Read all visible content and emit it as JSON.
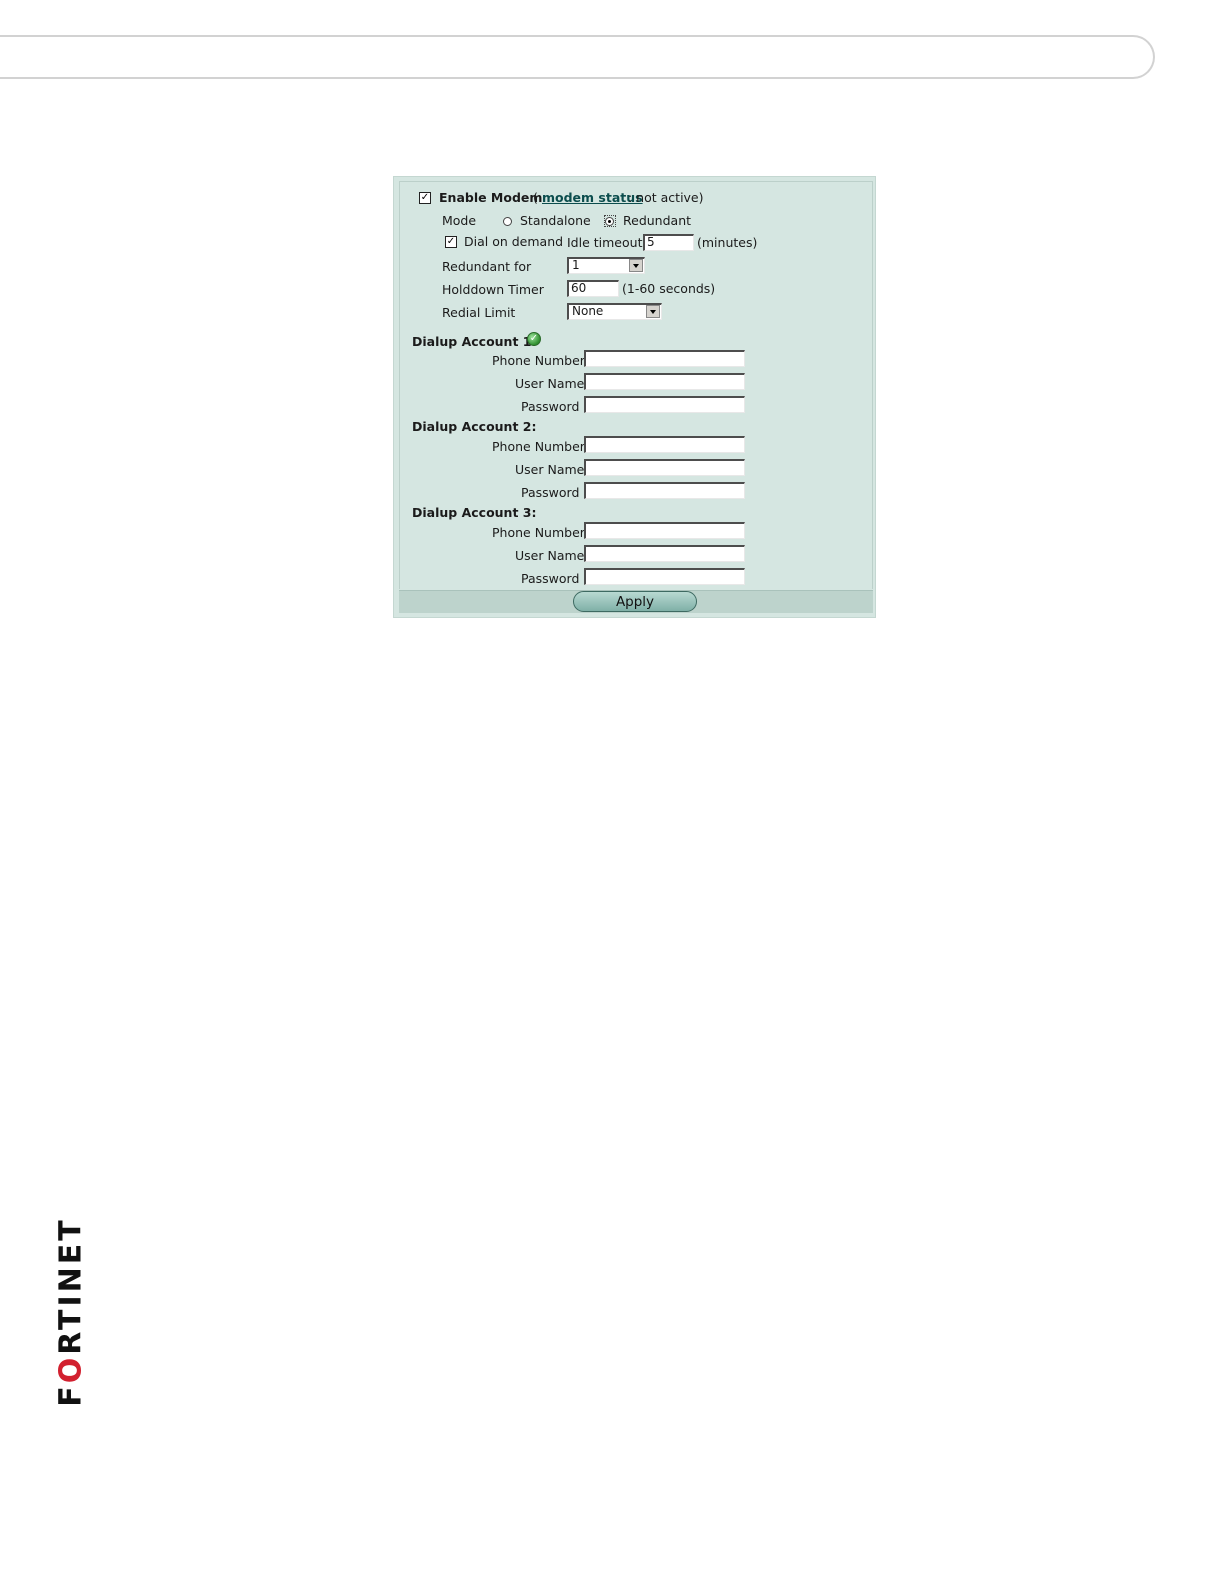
{
  "form": {
    "enable_modem_label": "Enable Modem",
    "status_open": "(",
    "modem_status_link": "modem status",
    "status_text": ": not active)",
    "mode_label": "Mode",
    "mode_standalone": "Standalone",
    "mode_redundant": "Redundant",
    "dial_on_demand_label": "Dial on demand",
    "idle_timeout_label": "Idle timeout",
    "idle_timeout_value": "5",
    "idle_timeout_unit": "(minutes)",
    "redundant_for_label": "Redundant for",
    "redundant_for_value": "1",
    "holddown_label": "Holddown Timer",
    "holddown_value": "60",
    "holddown_unit": "(1-60 seconds)",
    "redial_label": "Redial Limit",
    "redial_value": "None",
    "enable_modem_checked": true,
    "dial_on_demand_checked": true,
    "mode_selected": "Redundant"
  },
  "accounts": [
    {
      "title": "Dialup Account 1:",
      "phone_label": "Phone Number",
      "user_label": "User Name",
      "password_label": "Password",
      "phone": "",
      "user": "",
      "password": ""
    },
    {
      "title": "Dialup Account 2:",
      "phone_label": "Phone Number",
      "user_label": "User Name",
      "password_label": "Password",
      "phone": "",
      "user": "",
      "password": ""
    },
    {
      "title": "Dialup Account 3:",
      "phone_label": "Phone Number",
      "user_label": "User Name",
      "password_label": "Password",
      "phone": "",
      "user": "",
      "password": ""
    }
  ],
  "apply_label": "Apply",
  "logo": {
    "text_prefix": "F",
    "text_red": "O",
    "text_suffix": "RTINET",
    "brand_color": "#d2202f"
  },
  "icons": {
    "account1_status": "checkmark-ok-icon",
    "checkbox_glyph": "✓"
  },
  "colors": {
    "panel_bg": "#d5e6e1",
    "link": "#0b4d4d"
  }
}
